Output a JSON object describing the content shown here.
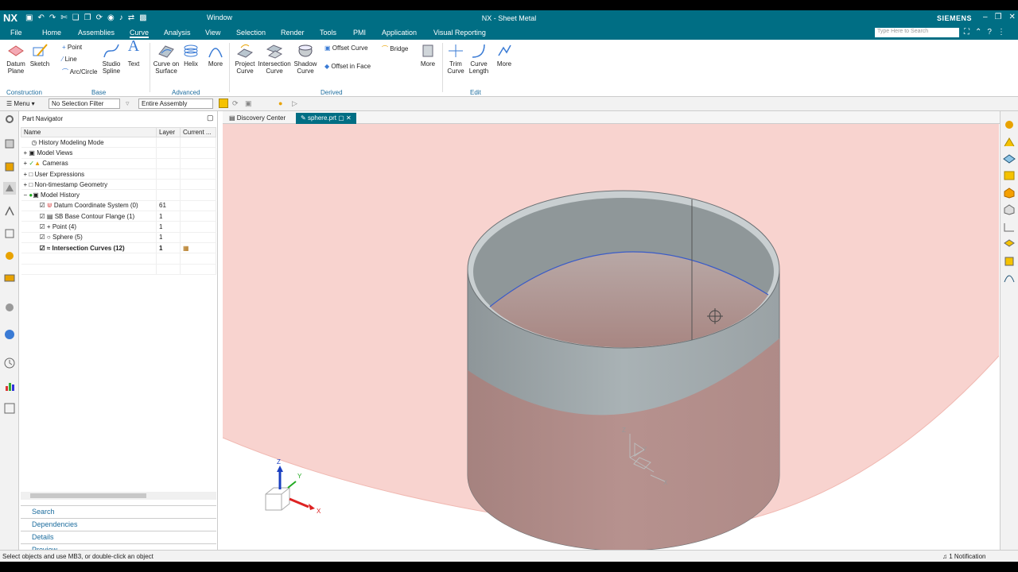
{
  "titlebar": {
    "logo": "NX",
    "window_label": "Window",
    "title": "NX - Sheet Metal",
    "brand": "SIEMENS"
  },
  "menubar": {
    "tabs": [
      "File",
      "Home",
      "Assemblies",
      "Curve",
      "Analysis",
      "View",
      "Selection",
      "Render",
      "Tools",
      "PMI",
      "Application",
      "Visual Reporting"
    ],
    "active_tab": "Curve",
    "search_placeholder": "Type Here to Search"
  },
  "ribbon": {
    "datum_plane": "Datum\nPlane",
    "sketch": "Sketch",
    "point": "Point",
    "line": "Line",
    "arc_circle": "Arc/Circle",
    "studio_spline": "Studio\nSpline",
    "text": "Text",
    "curve_on_surface": "Curve on\nSurface",
    "helix": "Helix",
    "more1": "More",
    "project_curve": "Project\nCurve",
    "intersection_curve": "Intersection\nCurve",
    "shadow_curve": "Shadow\nCurve",
    "offset_curve": "Offset Curve",
    "offset_in_face": "Offset in Face",
    "bridge": "Bridge",
    "more2": "More",
    "trim_curve": "Trim\nCurve",
    "curve_length": "Curve\nLength",
    "more3": "More",
    "groups": {
      "construction": "Construction",
      "base": "Base",
      "advanced": "Advanced",
      "derived": "Derived",
      "edit": "Edit"
    }
  },
  "selbar": {
    "menu": "Menu",
    "filter": "No Selection Filter",
    "scope": "Entire Assembly"
  },
  "navigator": {
    "title": "Part Navigator",
    "columns": [
      "Name",
      "Layer",
      "Current ..."
    ],
    "rows": [
      {
        "name": "History Modeling Mode",
        "layer": "",
        "current": ""
      },
      {
        "name": "Model Views",
        "layer": "",
        "current": ""
      },
      {
        "name": "Cameras",
        "layer": "",
        "current": ""
      },
      {
        "name": "User Expressions",
        "layer": "",
        "current": ""
      },
      {
        "name": "Non-timestamp Geometry",
        "layer": "",
        "current": ""
      },
      {
        "name": "Model History",
        "layer": "",
        "current": ""
      },
      {
        "name": "Datum Coordinate System (0)",
        "layer": "61",
        "current": ""
      },
      {
        "name": "SB Base Contour Flange (1)",
        "layer": "1",
        "current": ""
      },
      {
        "name": "Point (4)",
        "layer": "1",
        "current": ""
      },
      {
        "name": "Sphere (5)",
        "layer": "1",
        "current": ""
      },
      {
        "name": "Intersection Curves (12)",
        "layer": "1",
        "current": ""
      }
    ],
    "accordion": [
      "Search",
      "Dependencies",
      "Details",
      "Preview"
    ]
  },
  "doc_tabs": {
    "discovery": "Discovery Center",
    "part": "sphere.prt"
  },
  "viewport": {
    "triad_x": "X",
    "triad_y": "Y",
    "triad_z": "Z",
    "csys_x": "X",
    "csys_y": "Y",
    "csys_z": "Z"
  },
  "status": {
    "message": "Select objects and use MB3, or double-click an object",
    "notification": "1 Notification"
  },
  "colors": {
    "brand": "#006e84",
    "sphere": "#f6c3bd",
    "cylinder": "#a4adb0",
    "curve": "#3a5bc7"
  }
}
